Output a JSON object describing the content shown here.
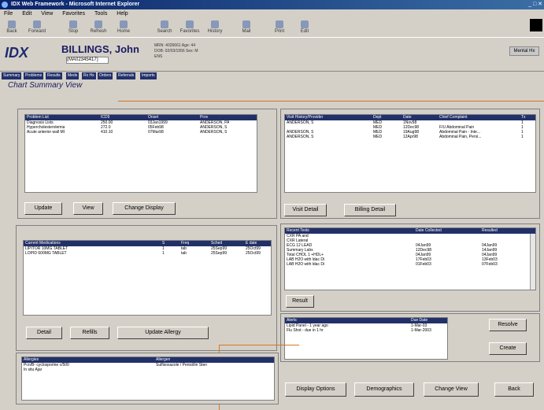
{
  "window": {
    "title": "IDX Web Framework - Microsoft Internet Explorer",
    "controls": "_ □ ✕"
  },
  "menu": [
    "File",
    "Edit",
    "View",
    "Favorites",
    "Tools",
    "Help"
  ],
  "toolbar": [
    {
      "label": "Back",
      "icon": "back-arrow-icon"
    },
    {
      "label": "Forward",
      "icon": "forward-arrow-icon"
    },
    {
      "label": "Stop",
      "icon": "stop-icon"
    },
    {
      "label": "Refresh",
      "icon": "refresh-icon"
    },
    {
      "label": "Home",
      "icon": "home-icon"
    },
    {
      "label": "Search",
      "icon": "search-icon"
    },
    {
      "label": "Favorites",
      "icon": "favorites-icon"
    },
    {
      "label": "History",
      "icon": "history-icon"
    },
    {
      "label": "Mail",
      "icon": "mail-icon"
    },
    {
      "label": "Print",
      "icon": "print-icon"
    },
    {
      "label": "Edit",
      "icon": "edit-icon"
    }
  ],
  "header": {
    "logo": "IDX",
    "patient_name": "BILLINGS, John",
    "mrn": "(MA02345417)",
    "info_lines": [
      "MRN: 4026661   Age: 44",
      "DOB: 02/03/1956   Sex: M",
      "ENS"
    ],
    "button": "Mental Hx"
  },
  "tabs": [
    "Summary",
    "Problems",
    "Results",
    "Meds",
    "Rx Hx",
    "Orders",
    "Referrals",
    "Imports"
  ],
  "view_title": "Chart Summary View",
  "problems": {
    "columns": [
      "Problem List",
      "ICD9",
      "Onset",
      "Prov"
    ],
    "rows": [
      [
        "Diagnosis Lists",
        "250.00",
        "03Jan1999",
        "ANDERSON, PA"
      ],
      [
        "Hypercholesterolemia",
        "272.0",
        "05Feb98",
        "ANDERSON, S"
      ],
      [
        "Acute anterior wall MI",
        "410.10",
        "07Mar98",
        "ANDERSON, S"
      ]
    ],
    "buttons": [
      "Update",
      "View",
      "Change Display"
    ]
  },
  "visits": {
    "columns": [
      "Visit History/Provider",
      "Dept",
      "Date",
      "Chief Complaint",
      "Tx"
    ],
    "rows": [
      [
        "ANDERSON, S",
        "MED",
        "1Nov98",
        "",
        "1"
      ],
      [
        "",
        "MED",
        "12Dec98",
        "F/U Abdominal Pain",
        "1"
      ],
      [
        "ANDERSON, S",
        "MED",
        "19Aug98",
        "Abdominal Pain - Inte...",
        "1"
      ],
      [
        "ANDERSON, S",
        "MED",
        "12Apr98",
        "Abdominal Pain, Persi...",
        "1"
      ]
    ],
    "buttons": [
      "Visit Detail",
      "Billing Detail"
    ]
  },
  "meds": {
    "columns": [
      "Current Medications",
      "S",
      "Freq",
      "Sched",
      "E date"
    ],
    "rows": [
      [
        "LIPITOR 10MG TABLET",
        "1",
        "tab",
        "25Sep99",
        "25Oct99"
      ],
      [
        "LOPID 600MG TABLET",
        "1",
        "tab",
        "25Sep99",
        "25Oct99"
      ]
    ],
    "buttons": [
      "Detail",
      "Refills",
      "Update Allergy"
    ]
  },
  "results": {
    "columns": [
      "Recent Tests",
      "Date Collected",
      "Resulted"
    ],
    "rows": [
      [
        "CXR PA and",
        "",
        ""
      ],
      [
        "CXR Lateral",
        "",
        ""
      ],
      [
        "ECG 12 LEAD",
        "04Jan99",
        "04Jan99"
      ],
      [
        "Summary Labs",
        "12Dec98",
        "14Jan99"
      ],
      [
        "Total CHOL 1 +HDL+",
        "04Jan99",
        "04Jan99"
      ],
      [
        "LAB H2O with ldac Di",
        "17Feb03",
        "13Feb03"
      ],
      [
        "LAB H2O with ldac Di",
        "01Feb03",
        "07Feb03"
      ]
    ],
    "button": "Result"
  },
  "alerts": {
    "columns": [
      "Alerts",
      "Due Date"
    ],
    "rows": [
      [
        "Lipid Panel - 1 year ago",
        "1-Mar-03"
      ],
      [
        "Flu Shot - due in 1 hr",
        "1-Mar-2003"
      ]
    ],
    "buttons": [
      "Resolve",
      "Create"
    ]
  },
  "allergies": {
    "columns": [
      "Allergies",
      "Allergen"
    ],
    "rows": [
      [
        "Pcn/B- cyclosporine c/500",
        "Sulfisoxazole / Penicillin Sten"
      ],
      [
        "In situ Ajar",
        ""
      ]
    ]
  },
  "bottom_buttons": [
    "Display Options",
    "Demographics",
    "Change View",
    "Back"
  ]
}
